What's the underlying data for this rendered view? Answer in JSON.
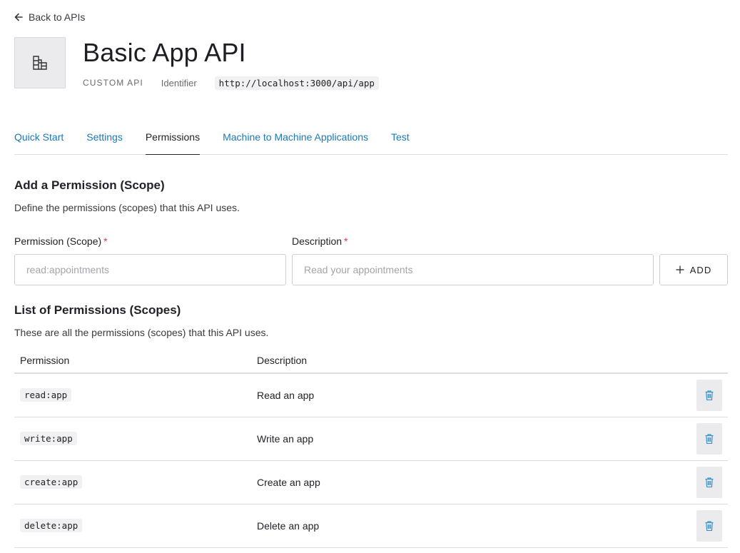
{
  "nav": {
    "back_label": "Back to APIs"
  },
  "api": {
    "title": "Basic App API",
    "type": "CUSTOM API",
    "identifier_label": "Identifier",
    "identifier_value": "http://localhost:3000/api/app"
  },
  "tabs": [
    {
      "label": "Quick Start"
    },
    {
      "label": "Settings"
    },
    {
      "label": "Permissions",
      "active": true
    },
    {
      "label": "Machine to Machine Applications"
    },
    {
      "label": "Test"
    }
  ],
  "add_section": {
    "title": "Add a Permission (Scope)",
    "description": "Define the permissions (scopes) that this API uses.",
    "permission_label": "Permission (Scope)",
    "permission_placeholder": "read:appointments",
    "description_label": "Description",
    "description_placeholder": "Read your appointments",
    "required_mark": "*",
    "add_label": "ADD"
  },
  "list_section": {
    "title": "List of Permissions (Scopes)",
    "description": "These are all the permissions (scopes) that this API uses.",
    "columns": [
      "Permission",
      "Description"
    ],
    "rows": [
      {
        "permission": "read:app",
        "description": "Read an app"
      },
      {
        "permission": "write:app",
        "description": "Write an app"
      },
      {
        "permission": "create:app",
        "description": "Create an app"
      },
      {
        "permission": "delete:app",
        "description": "Delete an app"
      }
    ]
  },
  "icons": {
    "back": "arrow-left-icon",
    "logo": "building-icon",
    "add": "plus-icon",
    "delete": "trash-icon"
  },
  "colors": {
    "link": "#1b78b9",
    "required": "#e0344a",
    "trash": "#3a93c9"
  }
}
